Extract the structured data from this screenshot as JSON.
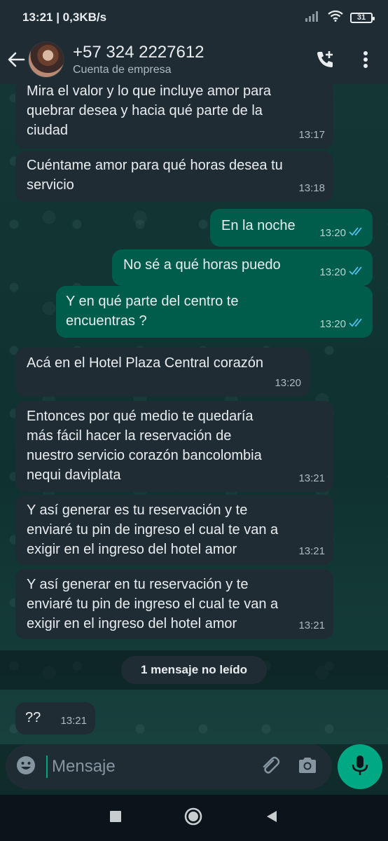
{
  "status_bar": {
    "time_speed": "13:21 | 0,3KB/s",
    "battery": "31"
  },
  "header": {
    "contact": "+57 324 2227612",
    "subtitle": "Cuenta de empresa"
  },
  "messages": [
    {
      "dir": "in",
      "text": "Mira el valor y lo que incluye amor para\nquebrar desea y hacia qué parte de la\nciudad",
      "time": "13:17"
    },
    {
      "dir": "in",
      "text": "Cuéntame amor para qué horas desea tu\nservicio",
      "time": "13:18"
    },
    {
      "dir": "out",
      "text": "En la noche",
      "time": "13:20"
    },
    {
      "dir": "out",
      "text": "No sé a qué horas puedo",
      "time": "13:20"
    },
    {
      "dir": "out",
      "text": "Y en qué parte del centro te\nencuentras ?",
      "time": "13:20"
    },
    {
      "dir": "in",
      "text": "Acá en el Hotel Plaza Central corazón",
      "time": "13:20"
    },
    {
      "dir": "in",
      "text": "Entonces por qué medio te quedaría\nmás fácil hacer la reservación de\nnuestro servicio corazón bancolombia\nnequi daviplata",
      "time": "13:21"
    },
    {
      "dir": "in",
      "text": "Y así generar es tu reservación y te\nenviaré tu pin de ingreso el cual te van a\nexigir en el ingreso del hotel amor",
      "time": "13:21"
    },
    {
      "dir": "in",
      "text": "Y así generar en tu reservación y te\nenviaré tu pin de ingreso el cual te van a\nexigir en el ingreso del hotel amor",
      "time": "13:21"
    },
    {
      "dir": "in",
      "text": "??",
      "time": "13:21"
    }
  ],
  "unread_label": "1 mensaje no leído",
  "composer": {
    "placeholder": "Mensaje"
  },
  "icons": [
    "back-arrow-icon",
    "add-call-icon",
    "more-vert-icon",
    "emoji-icon",
    "attach-icon",
    "camera-icon",
    "mic-icon",
    "read-ticks-icon",
    "signal-icon",
    "wifi-icon",
    "nav-square-icon",
    "nav-circle-icon",
    "nav-triangle-icon"
  ],
  "colors": {
    "header": "#1f2c34",
    "incoming": "#1f2c34",
    "outgoing": "#005c4b",
    "accent": "#00a884",
    "ticks": "#53bdeb"
  }
}
